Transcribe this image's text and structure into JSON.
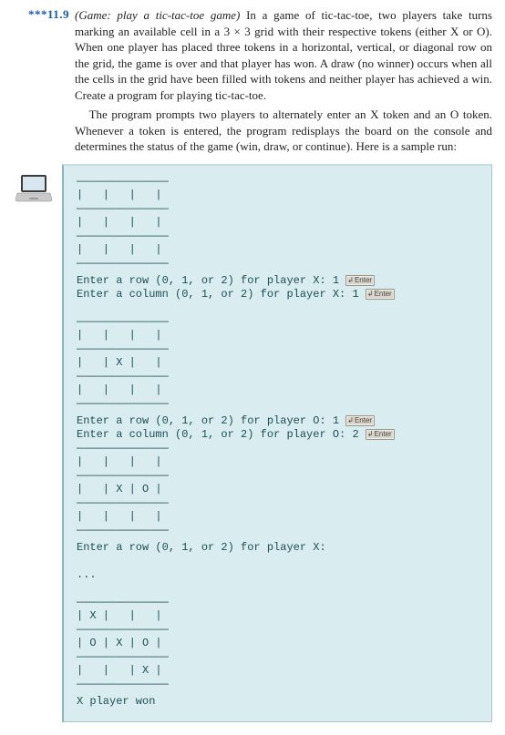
{
  "exercise": {
    "number": "***11.9",
    "title_italic": "(Game: play a tic-tac-toe game)",
    "para1_rest": " In a game of tic-tac-toe, two players take turns marking an available cell in a 3 × 3 grid with their respective tokens (either X or O). When one player has placed three tokens in a horizontal, vertical, or diagonal row on the grid, the game is over and that player has won. A draw (no winner) occurs when all the cells in the grid have been filled with tokens and neither player has achieved a win. Create a program for playing tic-tac-toe.",
    "para2": "The program prompts two players to alternately enter an X token and an O token. Whenever a token is entered, the program redisplays the board on the console and determines the status of the game (win, draw, or continue). Here is a sample run:"
  },
  "console": {
    "divider": "——————————————",
    "row_empty": "|   |   |   |",
    "prompt_rx": "Enter a row (0, 1, or 2) for player X: ",
    "prompt_cx": "Enter a column (0, 1, or 2) for player X: ",
    "prompt_ro": "Enter a row (0, 1, or 2) for player O: ",
    "prompt_co": "Enter a column (0, 1, or 2) for player O: ",
    "prompt_rx2": "Enter a row (0, 1, or 2) for player X:",
    "val_rx": "1",
    "val_cx": "1",
    "val_ro": "1",
    "val_co": "2",
    "row_x_mid": "|   | X |   |",
    "row_xo_mid": "|   | X | O |",
    "final_r0": "| X |   |   |",
    "final_r1": "| O | X | O |",
    "final_r2": "|   |   | X |",
    "ellipsis": "...",
    "winner": "X player won",
    "enter_label": "Enter"
  }
}
